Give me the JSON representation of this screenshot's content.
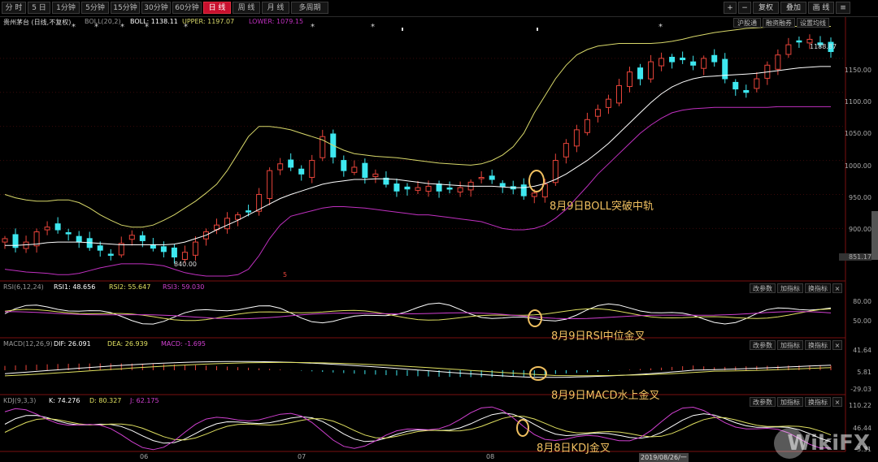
{
  "toolbar": {
    "buttons": [
      "分 时",
      "5 日",
      "1分钟",
      "5分钟",
      "15分钟",
      "30分钟",
      "60分钟",
      "日 线",
      "周 线",
      "月 线",
      "多周期"
    ],
    "active_index": 7,
    "right": [
      "+",
      "−",
      "复权",
      "叠加",
      "画 线",
      "≡"
    ]
  },
  "stock": {
    "name": "贵州茅台 (日线,不复权)",
    "boll_name": "BOLL(20,2)",
    "boll_mid": "BOLL: 1138.11",
    "boll_upper": "UPPER: 1197.07",
    "boll_lower": "LOWER: 1079.15",
    "right_btns": [
      "沪股通",
      "融资融券",
      "设置均线"
    ]
  },
  "rsi": {
    "name": "RSI(6,12,24)",
    "rsi1": "RSI1: 48.656",
    "rsi2": "RSI2: 55.647",
    "rsi3": "RSI3: 59.030"
  },
  "macd": {
    "name": "MACD(12,26,9)",
    "dif": "DIF: 26.091",
    "dea": "DEA: 26.939",
    "macd": "MACD: -1.695"
  },
  "kdj": {
    "name": "KDJ(9,3,3)",
    "k": "K: 74.276",
    "d": "D: 80.327",
    "j": "J: 62.175"
  },
  "panel_btns": [
    "改参数",
    "加指标",
    "换指标"
  ],
  "axes": {
    "price": [
      "1150.00",
      "1100.00",
      "1050.00",
      "1000.00",
      "950.00",
      "900.00",
      "851.17"
    ],
    "rsi": [
      "80.00",
      "50.00"
    ],
    "macd": [
      "41.64",
      "5.81",
      "-29.03"
    ],
    "kdj": [
      "110.22",
      "46.44",
      "-3.31"
    ],
    "months": [
      "06",
      "07",
      "08"
    ],
    "date_box": "2019/08/26/一"
  },
  "marks": {
    "high": "1188.87",
    "low": "840.00",
    "mid_marker": "5"
  },
  "annotations": {
    "boll": "8月9日BOLL突破中轨",
    "rsi": "8月9日RSI中位金叉",
    "macd": "8月9日MACD水上金叉",
    "kdj": "8月8日KDJ金叉"
  },
  "watermark": "WikiFX",
  "colors": {
    "up": "#e8443a",
    "down": "#3ee8f0",
    "mid": "#ffffff",
    "upper": "#d9d96a",
    "lower": "#c030c0",
    "anno": "#f0c060",
    "dif": "#ffffff",
    "dea": "#e0e060",
    "kdj_j": "#d040d0"
  },
  "chart_data": {
    "type": "candlestick",
    "title": "贵州茅台 (日线,不复权)",
    "ylim": [
      830,
      1200
    ],
    "closes": [
      885,
      872,
      880,
      895,
      902,
      898,
      892,
      880,
      872,
      868,
      862,
      878,
      890,
      882,
      871,
      866,
      858,
      865,
      880,
      895,
      905,
      915,
      920,
      925,
      950,
      985,
      995,
      990,
      980,
      1000,
      1035,
      1005,
      985,
      990,
      975,
      980,
      965,
      955,
      958,
      960,
      962,
      955,
      958,
      960,
      968,
      975,
      972,
      962,
      958,
      948,
      952,
      965,
      1000,
      1025,
      1045,
      1060,
      1075,
      1090,
      1110,
      1130,
      1120,
      1145,
      1150,
      1145,
      1148,
      1140,
      1150,
      1145,
      1120,
      1105,
      1100,
      1120,
      1140,
      1155,
      1170,
      1175,
      1178,
      1170,
      1160
    ],
    "mid_band": [
      875,
      875,
      876,
      877,
      879,
      880,
      880,
      880,
      879,
      878,
      877,
      876,
      876,
      876,
      876,
      876,
      877,
      880,
      885,
      890,
      898,
      905,
      912,
      920,
      928,
      936,
      944,
      950,
      955,
      960,
      965,
      968,
      970,
      972,
      972,
      973,
      973,
      972,
      970,
      968,
      966,
      965,
      964,
      963,
      962,
      962,
      962,
      961,
      960,
      960,
      962,
      966,
      972,
      980,
      990,
      1000,
      1012,
      1025,
      1040,
      1055,
      1070,
      1085,
      1098,
      1108,
      1115,
      1120,
      1123,
      1124,
      1125,
      1126,
      1127,
      1128,
      1130,
      1132,
      1134,
      1136,
      1137,
      1138,
      1138
    ],
    "upper_band": [
      950,
      945,
      942,
      940,
      940,
      942,
      942,
      938,
      930,
      920,
      912,
      905,
      902,
      902,
      905,
      912,
      920,
      930,
      940,
      952,
      965,
      985,
      1010,
      1035,
      1050,
      1050,
      1048,
      1045,
      1040,
      1035,
      1030,
      1022,
      1015,
      1010,
      1008,
      1006,
      1005,
      1004,
      1002,
      1000,
      998,
      996,
      995,
      994,
      993,
      995,
      1000,
      1008,
      1020,
      1040,
      1070,
      1095,
      1120,
      1140,
      1155,
      1163,
      1168,
      1170,
      1172,
      1172,
      1172,
      1172,
      1173,
      1175,
      1178,
      1182,
      1185,
      1188,
      1190,
      1192,
      1194,
      1195,
      1196,
      1197,
      1197,
      1197,
      1197,
      1197,
      1197
    ],
    "lower_band": [
      840,
      838,
      836,
      835,
      834,
      832,
      832,
      834,
      838,
      842,
      845,
      848,
      848,
      848,
      847,
      845,
      840,
      835,
      832,
      830,
      830,
      830,
      832,
      840,
      860,
      885,
      905,
      918,
      922,
      926,
      930,
      932,
      932,
      931,
      930,
      928,
      926,
      924,
      922,
      920,
      920,
      918,
      916,
      914,
      912,
      910,
      905,
      900,
      898,
      898,
      900,
      905,
      915,
      928,
      945,
      962,
      980,
      995,
      1010,
      1025,
      1040,
      1052,
      1062,
      1070,
      1074,
      1076,
      1077,
      1078,
      1078,
      1078,
      1078,
      1078,
      1078,
      1079,
      1079,
      1079,
      1079,
      1079,
      1079
    ],
    "rsi_labels": [
      "RSI1",
      "RSI2",
      "RSI3"
    ],
    "macd_labels": [
      "DIF",
      "DEA",
      "MACD"
    ],
    "kdj_labels": [
      "K",
      "D",
      "J"
    ]
  }
}
